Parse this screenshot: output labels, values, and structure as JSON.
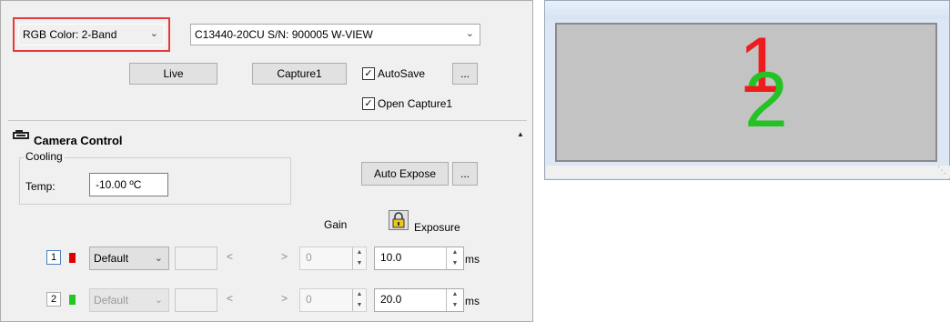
{
  "toolbar": {
    "mode_select": "RGB Color: 2-Band",
    "camera_select": "C13440-20CU S/N: 900005 W-VIEW",
    "live_label": "Live",
    "capture_label": "Capture1",
    "autosave_label": "AutoSave",
    "ellipsis_label": "...",
    "open_capture_label": "Open Capture1",
    "autosave_checked": true,
    "open_capture_checked": true,
    "highlight_color": "#e8393a"
  },
  "camera_control": {
    "title": "Camera Control",
    "collapse_icon": "triangle-up-icon",
    "cooling_label": "Cooling",
    "temp_label": "Temp:",
    "temp_value": "-10.00 ºC",
    "auto_expose_label": "Auto Expose",
    "ellipsis_label": "...",
    "gain_label": "Gain",
    "exposure_label": "Exposure",
    "lock_icon": "padlock-icon"
  },
  "channels": [
    {
      "number": "1",
      "color": "#e00000",
      "preset": "Default",
      "gain": "0",
      "exposure": "10.0",
      "unit": "ms",
      "enabled": true
    },
    {
      "number": "2",
      "color": "#21c821",
      "preset": "Default",
      "gain": "0",
      "exposure": "20.0",
      "unit": "ms",
      "enabled": false
    }
  ],
  "preview": {
    "band1_label": "1",
    "band2_label": "2",
    "band1_color": "#ee1c1c",
    "band2_color": "#22c322"
  }
}
